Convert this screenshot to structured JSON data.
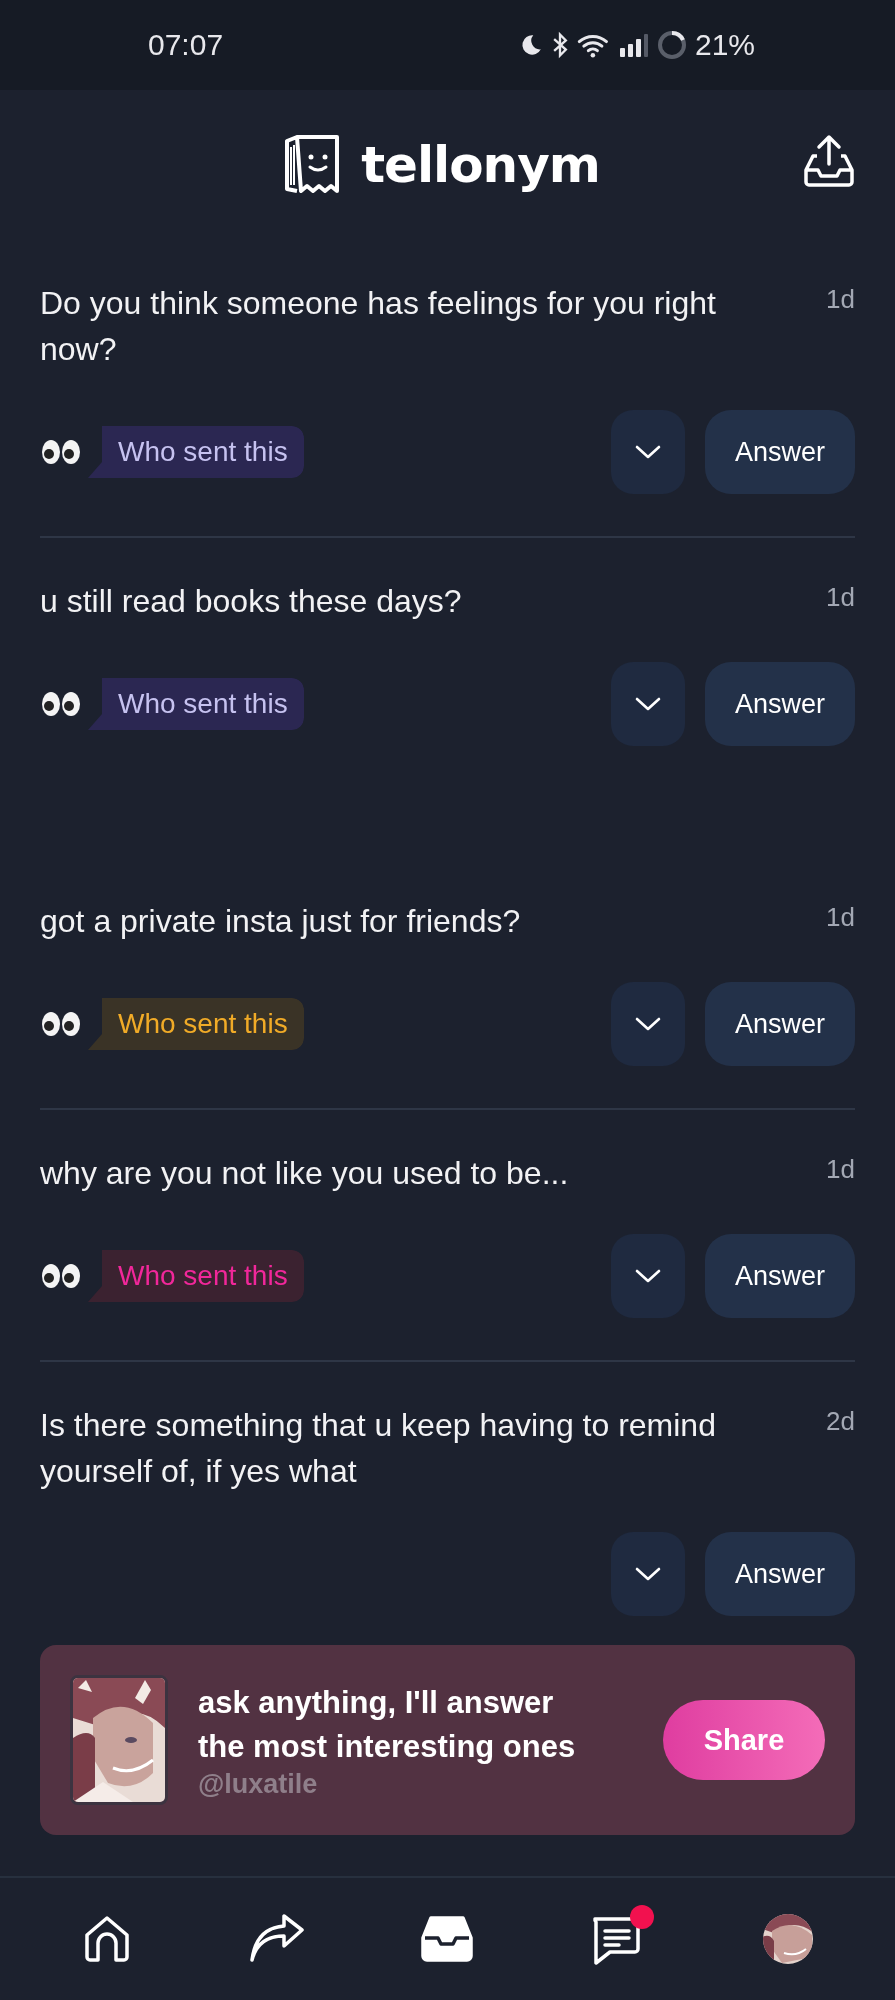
{
  "status_bar": {
    "time": "07:07",
    "battery": "21%"
  },
  "header": {
    "logo": "tellonym"
  },
  "questions": [
    {
      "text": "Do you think someone has feelings for you right now?",
      "age": "1d",
      "pill": "Who sent this",
      "color": "#2b2752",
      "divider": true,
      "answer": "Answer"
    },
    {
      "text": "u still read books these days?",
      "age": "1d",
      "pill": "Who sent this",
      "color": "#2b2752",
      "divider": false,
      "answer": "Answer"
    },
    {
      "text": "got a private insta just for friends?",
      "age": "1d",
      "pill": "Who sent this",
      "color": "#3a3326",
      "divider": true,
      "answer": "Answer"
    },
    {
      "text": "why are you not like you used to be...",
      "age": "1d",
      "pill": "Who sent this",
      "color": "#3b2230",
      "divider": true,
      "answer": "Answer"
    },
    {
      "text": "Is there something that u keep having to remind yourself of, if yes what",
      "age": "2d",
      "divider": false,
      "answer": "Answer"
    }
  ],
  "share_card": {
    "text": "ask anything, I'll answer the most interesting ones",
    "handle": "@luxatile",
    "button": "Share"
  },
  "nav": {
    "items": [
      {
        "kind": "home",
        "selected": false
      },
      {
        "kind": "share",
        "selected": false
      },
      {
        "kind": "inbox",
        "selected": true
      },
      {
        "kind": "chat",
        "selected": false,
        "badge": true
      },
      {
        "kind": "profile",
        "selected": false
      }
    ]
  }
}
